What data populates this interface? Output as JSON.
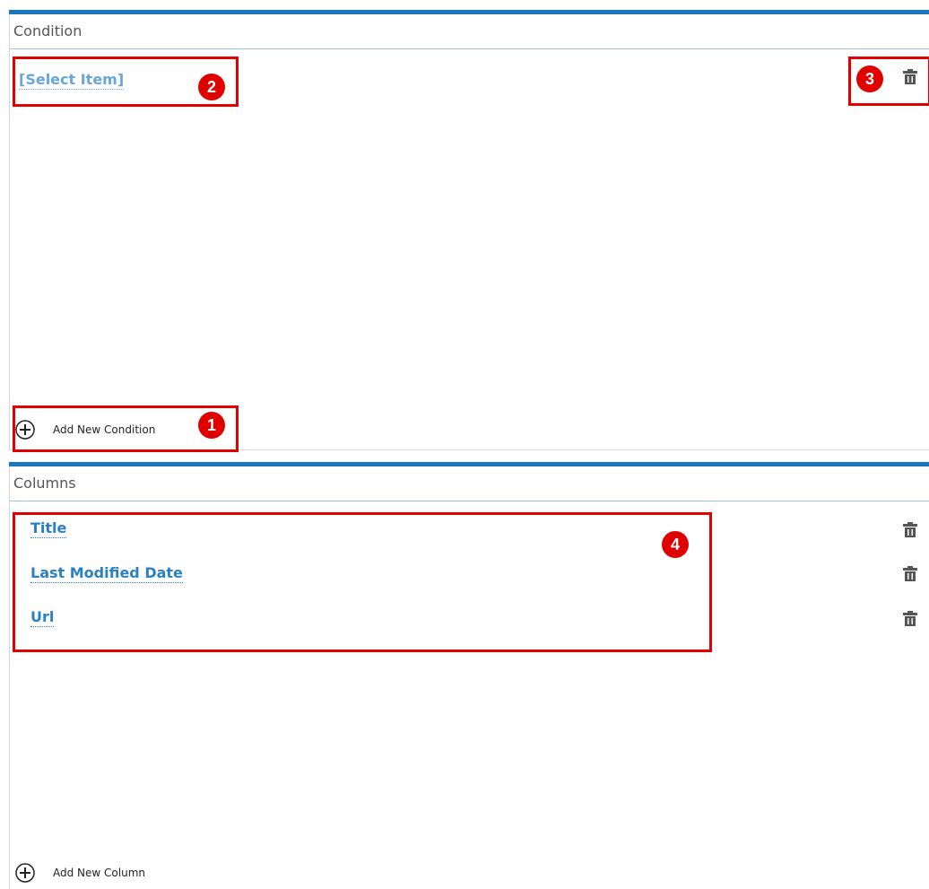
{
  "condition_panel": {
    "title": "Condition",
    "select_item": "[Select Item]",
    "add_label": "Add New Condition"
  },
  "columns_panel": {
    "title": "Columns",
    "columns": [
      "Title",
      "Last Modified Date",
      "Url"
    ],
    "add_label": "Add New Column"
  },
  "annotations": [
    "1",
    "2",
    "3",
    "4"
  ],
  "colors": {
    "accent": "#1a76bf",
    "link": "#2a80c6",
    "annotation": "#e00000"
  },
  "icons": [
    "trash-icon",
    "plus-circle-icon"
  ]
}
